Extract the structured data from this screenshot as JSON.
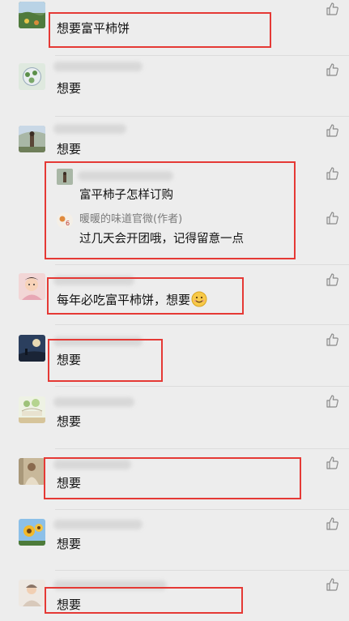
{
  "comments": [
    {
      "text": "想要富平柿饼"
    },
    {
      "text": "想要"
    },
    {
      "text": "想要"
    },
    {
      "text": "每年必吃富平柿饼，想要"
    },
    {
      "text": "想要"
    },
    {
      "text": "想要"
    },
    {
      "text": "想要"
    },
    {
      "text": "想要"
    },
    {
      "text": "想要"
    }
  ],
  "replies": {
    "question": "富平柿子怎样订购",
    "author_name": "暖暖的味道官微(作者)",
    "answer": "过几天会开团哦，记得留意一点"
  },
  "icons": {
    "like": "thumbs-up-icon",
    "emoji": "smile-emoji-icon"
  },
  "colors": {
    "highlight": "#e53935",
    "background": "#ededed",
    "author_name": "#7c7c7c"
  }
}
